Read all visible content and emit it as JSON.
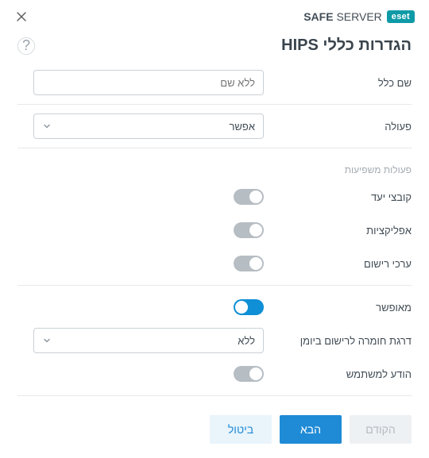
{
  "header": {
    "brand_prefix": "eset",
    "brand_bold": "SAFE",
    "brand_rest": "SERVER"
  },
  "title": "הגדרות כללי HIPS",
  "help_char": "?",
  "fields": {
    "rule_name_label": "שם כלל",
    "rule_name_placeholder": "ללא שם",
    "action_label": "פעולה",
    "action_value": "אפשר",
    "affecting_subtitle": "פעולות משפיעות",
    "target_files_label": "קובצי יעד",
    "applications_label": "אפליקציות",
    "registry_label": "ערכי רישום",
    "enabled_label": "מאופשר",
    "severity_label": "דרגת חומרה לרישום ביומן",
    "severity_value": "ללא",
    "notify_label": "הודע למשתמש"
  },
  "toggles": {
    "target_files": false,
    "applications": false,
    "registry": false,
    "enabled": true,
    "notify": false
  },
  "footer": {
    "prev": "הקודם",
    "next": "הבא",
    "cancel": "ביטול"
  }
}
